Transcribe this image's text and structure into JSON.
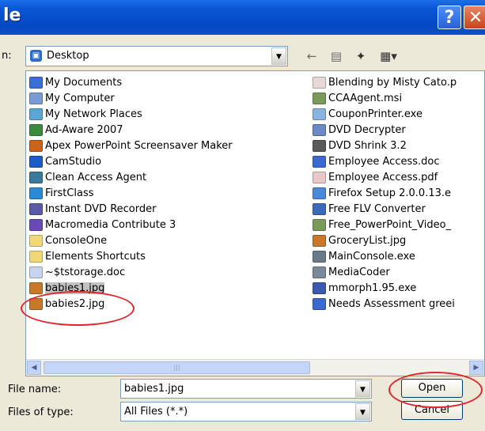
{
  "window": {
    "title": "le"
  },
  "lookin": {
    "label": "n:",
    "value": "Desktop"
  },
  "toolbar_icons": [
    "back-icon",
    "up-folder-icon",
    "new-folder-icon",
    "view-menu-icon"
  ],
  "files_col1": [
    {
      "name": "My Documents",
      "icon": "my-documents-icon",
      "color": "#3a6fd8"
    },
    {
      "name": "My Computer",
      "icon": "my-computer-icon",
      "color": "#7b9bd6"
    },
    {
      "name": "My Network Places",
      "icon": "network-icon",
      "color": "#5aa6d6"
    },
    {
      "name": "Ad-Aware 2007",
      "icon": "adaware-icon",
      "color": "#3c8a3c"
    },
    {
      "name": "Apex PowerPoint Screensaver Maker",
      "icon": "apex-icon",
      "color": "#c8641c"
    },
    {
      "name": "CamStudio",
      "icon": "camstudio-icon",
      "color": "#1c5cc8"
    },
    {
      "name": "Clean Access Agent",
      "icon": "clean-access-icon",
      "color": "#3a7a9a"
    },
    {
      "name": "FirstClass",
      "icon": "firstclass-icon",
      "color": "#2a8ad6"
    },
    {
      "name": "Instant DVD Recorder",
      "icon": "dvd-recorder-icon",
      "color": "#5a5aa8"
    },
    {
      "name": "Macromedia Contribute 3",
      "icon": "contribute-icon",
      "color": "#6a48b8"
    },
    {
      "name": "ConsoleOne",
      "icon": "folder-icon",
      "color": "#f0d878"
    },
    {
      "name": "Elements Shortcuts",
      "icon": "folder-icon",
      "color": "#f0d878"
    },
    {
      "name": "~$tstorage.doc",
      "icon": "word-doc-icon",
      "color": "#c8d4ee"
    },
    {
      "name": "babies1.jpg",
      "icon": "jpg-image-icon",
      "color": "#c87828"
    },
    {
      "name": "babies2.jpg",
      "icon": "jpg-image-icon",
      "color": "#c87828"
    }
  ],
  "files_col2": [
    {
      "name": "Blending by Misty Cato.p",
      "icon": "pdf-icon",
      "color": "#e8d8d8"
    },
    {
      "name": "CCAAgent.msi",
      "icon": "msi-icon",
      "color": "#7a9a5a"
    },
    {
      "name": "CouponPrinter.exe",
      "icon": "exe-icon",
      "color": "#8ab4e0"
    },
    {
      "name": "DVD Decrypter",
      "icon": "dvd-icon",
      "color": "#6a8ac8"
    },
    {
      "name": "DVD Shrink 3.2",
      "icon": "dvd-shrink-icon",
      "color": "#5a5a5a"
    },
    {
      "name": "Employee Access.doc",
      "icon": "word-doc-icon",
      "color": "#3a6ad0"
    },
    {
      "name": "Employee Access.pdf",
      "icon": "pdf-icon",
      "color": "#e8c8c8"
    },
    {
      "name": "Firefox Setup 2.0.0.13.e",
      "icon": "firefox-icon",
      "color": "#4a8ad8"
    },
    {
      "name": "Free FLV Converter",
      "icon": "flv-icon",
      "color": "#3a6ab8"
    },
    {
      "name": "Free_PowerPoint_Video_",
      "icon": "msi-icon",
      "color": "#7a9a5a"
    },
    {
      "name": "GroceryList.jpg",
      "icon": "jpg-image-icon",
      "color": "#c87828"
    },
    {
      "name": "MainConsole.exe",
      "icon": "exe-icon",
      "color": "#6a7a8a"
    },
    {
      "name": "MediaCoder",
      "icon": "mediacoder-icon",
      "color": "#7a8a9a"
    },
    {
      "name": "mmorph1.95.exe",
      "icon": "exe-icon",
      "color": "#3a5ab0"
    },
    {
      "name": "Needs Assessment greei",
      "icon": "word-doc-icon",
      "color": "#3a6ad0"
    }
  ],
  "selected_file": "babies1.jpg",
  "filename": {
    "label": "File name:",
    "value": "babies1.jpg"
  },
  "filetype": {
    "label": "Files of type:",
    "value": "All Files (*.*)"
  },
  "buttons": {
    "open": "Open",
    "cancel": "Cancel"
  }
}
